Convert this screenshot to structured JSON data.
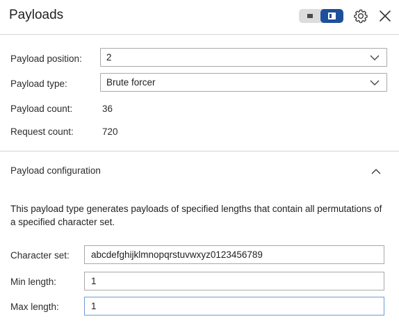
{
  "header": {
    "title": "Payloads",
    "toggle_active": "right",
    "icons": {
      "toggle": "layout-toggle-icon",
      "settings": "gear-icon",
      "close": "close-icon"
    },
    "accent_color": "#1e4f9a"
  },
  "settings": {
    "position_label": "Payload position:",
    "position_value": "2",
    "type_label": "Payload type:",
    "type_value": "Brute forcer",
    "count_label": "Payload count:",
    "count_value": "36",
    "request_label": "Request count:",
    "request_value": "720"
  },
  "config": {
    "title": "Payload configuration",
    "expanded": true,
    "description": "This payload type generates payloads of specified lengths that contain all permutations of a specified character set.",
    "charset_label": "Character set:",
    "charset_value": "abcdefghijklmnopqrstuvwxyz0123456789",
    "min_label": "Min length:",
    "min_value": "1",
    "max_label": "Max length:",
    "max_value": "1"
  }
}
